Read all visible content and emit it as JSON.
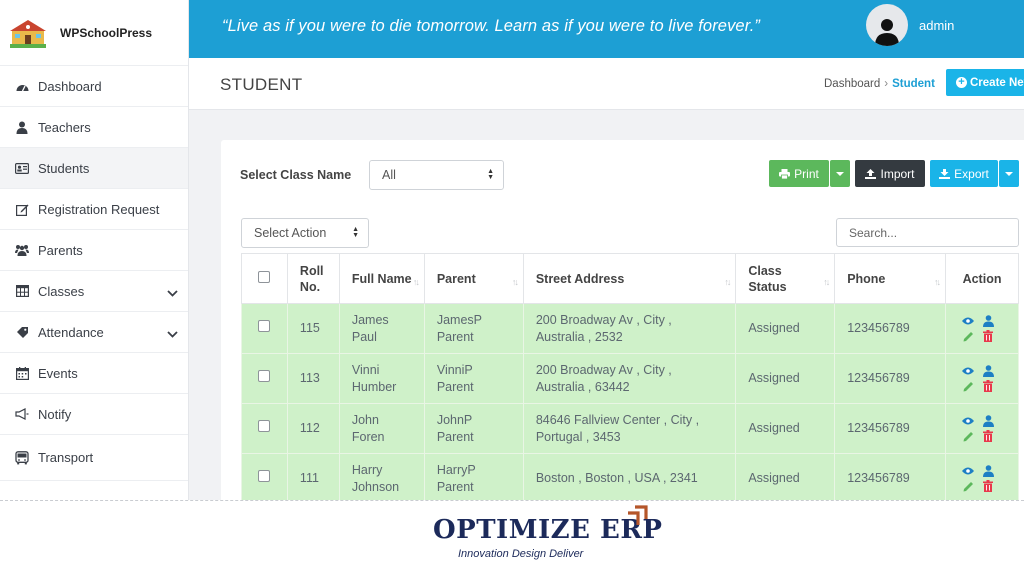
{
  "app": {
    "brand_name": "WPSchoolPress"
  },
  "header": {
    "quote": "“Live as if you were to die tomorrow. Learn as if you were to live forever.”",
    "username": "admin"
  },
  "sidebar": {
    "items": [
      {
        "label": "Dashboard",
        "icon": "dashboard-icon"
      },
      {
        "label": "Teachers",
        "icon": "teacher-icon"
      },
      {
        "label": "Students",
        "icon": "id-card-icon",
        "active": true
      },
      {
        "label": "Registration Request",
        "icon": "edit-icon"
      },
      {
        "label": "Parents",
        "icon": "users-icon"
      },
      {
        "label": "Classes",
        "icon": "table-icon",
        "expandable": true
      },
      {
        "label": "Attendance",
        "icon": "tag-icon",
        "expandable": true
      },
      {
        "label": "Events",
        "icon": "calendar-icon"
      },
      {
        "label": "Notify",
        "icon": "megaphone-icon"
      },
      {
        "label": "Transport",
        "icon": "bus-icon"
      }
    ]
  },
  "page": {
    "title": "STUDENT",
    "breadcrumb": {
      "home": "Dashboard",
      "current": "Student"
    },
    "create_label": "Create New"
  },
  "toolbar": {
    "class_label": "Select Class Name",
    "class_value": "All",
    "print_label": "Print",
    "import_label": "Import",
    "export_label": "Export",
    "action_value": "Select Action",
    "search_placeholder": "Search..."
  },
  "table": {
    "headers": {
      "roll": "Roll No.",
      "name": "Full Name",
      "parent": "Parent",
      "address": "Street Address",
      "status": "Class Status",
      "phone": "Phone",
      "action": "Action"
    },
    "rows": [
      {
        "roll": "115",
        "name": "James Paul",
        "parent": "JamesP Parent",
        "address": "200 Broadway Av , City , Australia , 2532",
        "status": "Assigned",
        "phone": "123456789"
      },
      {
        "roll": "113",
        "name": "Vinni Humber",
        "parent": "VinniP Parent",
        "address": "200 Broadway Av , City , Australia , 63442",
        "status": "Assigned",
        "phone": "123456789"
      },
      {
        "roll": "112",
        "name": "John Foren",
        "parent": "JohnP Parent",
        "address": "84646 Fallview Center , City , Portugal , 3453",
        "status": "Assigned",
        "phone": "123456789"
      },
      {
        "roll": "111",
        "name": "Harry Johnson",
        "parent": "HarryP Parent",
        "address": "Boston , Boston , USA , 2341",
        "status": "Assigned",
        "phone": "123456789"
      }
    ]
  },
  "footer": {
    "brand": "OPTIMIZE ERP",
    "tagline": "Innovation Design Deliver"
  },
  "colors": {
    "primary": "#1d9fd4",
    "success": "#5cb85c",
    "dark": "#343a40",
    "row_highlight": "#cff1c9",
    "danger": "#e8394b"
  }
}
